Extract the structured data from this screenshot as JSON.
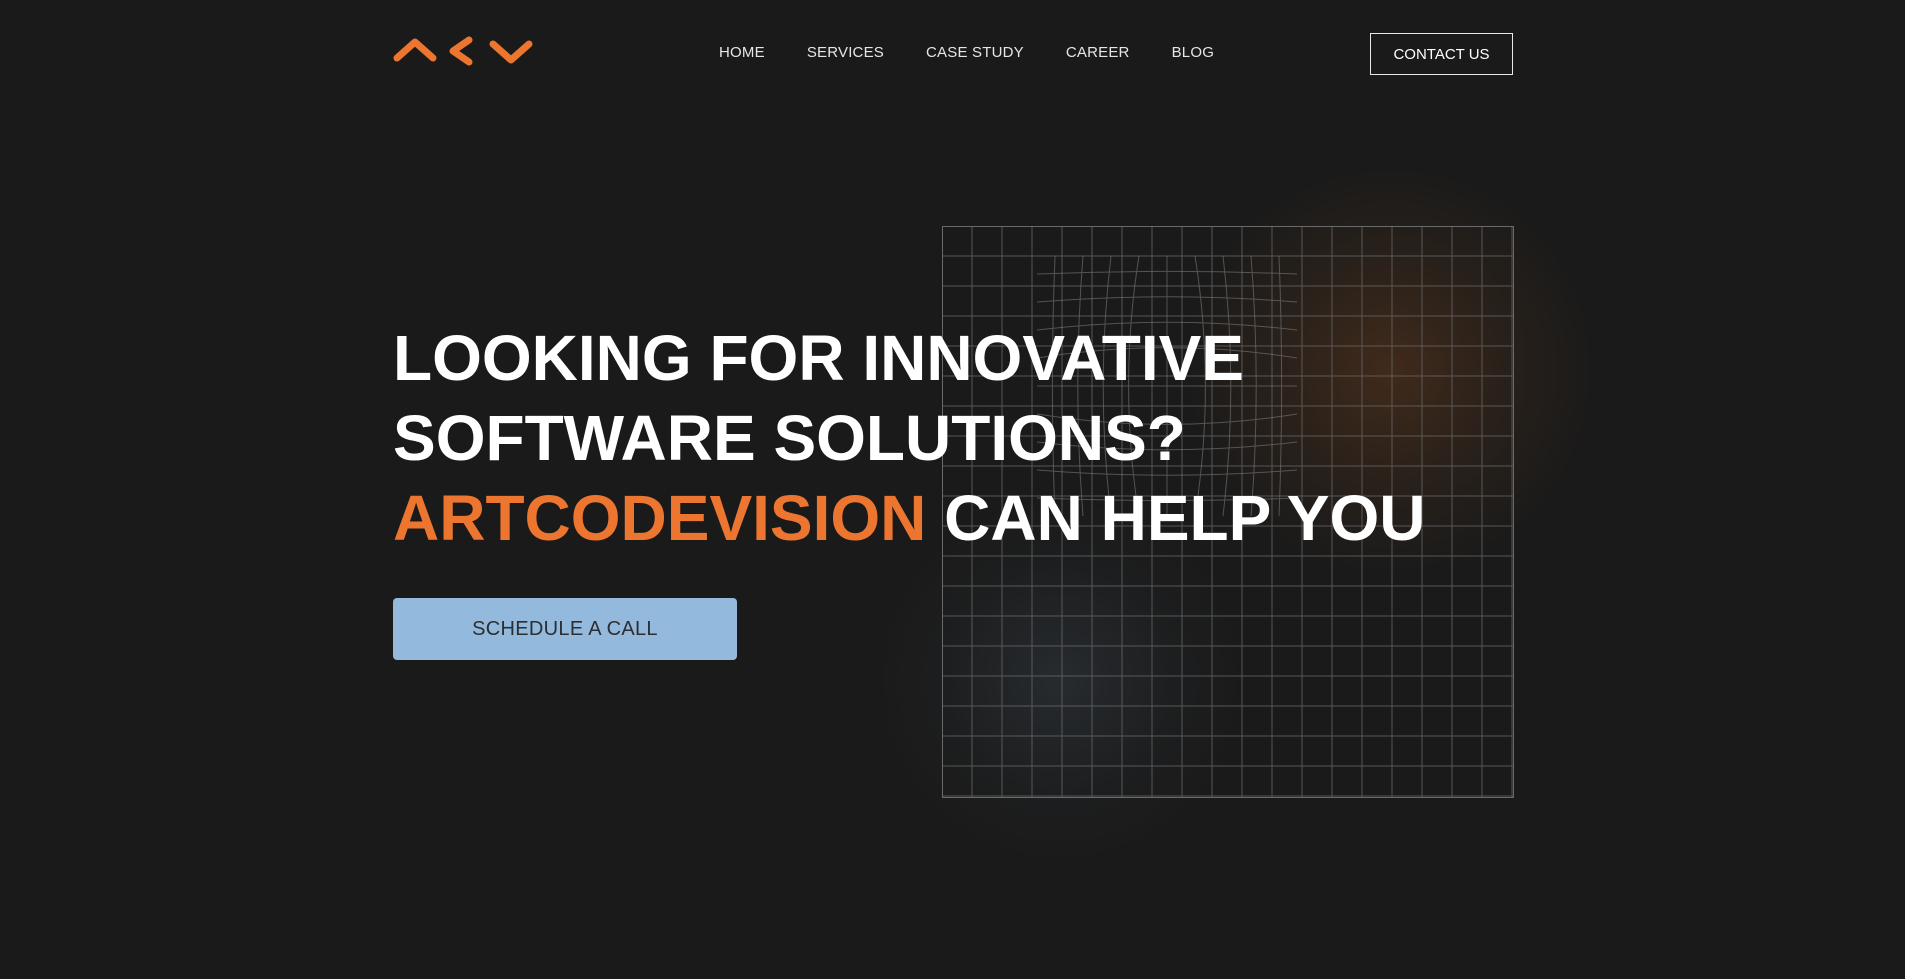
{
  "brand": {
    "logo_icon": "acv-chevrons-logo",
    "accent_color": "#ec7630"
  },
  "nav": {
    "items": [
      {
        "label": "HOME"
      },
      {
        "label": "SERVICES"
      },
      {
        "label": "CASE STUDY"
      },
      {
        "label": "CAREER"
      },
      {
        "label": "BLOG"
      }
    ],
    "contact_label": "CONTACT US"
  },
  "hero": {
    "line1": "LOOKING FOR INNOVATIVE",
    "line2": "SOFTWARE SOLUTIONS?",
    "line3_accent": "ARTCODEVISION",
    "line3_rest": " CAN HELP YOU",
    "cta_label": "SCHEDULE A CALL",
    "cta_color": "#93b9dc"
  },
  "colors": {
    "background": "#1a1a1a",
    "text": "#ffffff"
  }
}
